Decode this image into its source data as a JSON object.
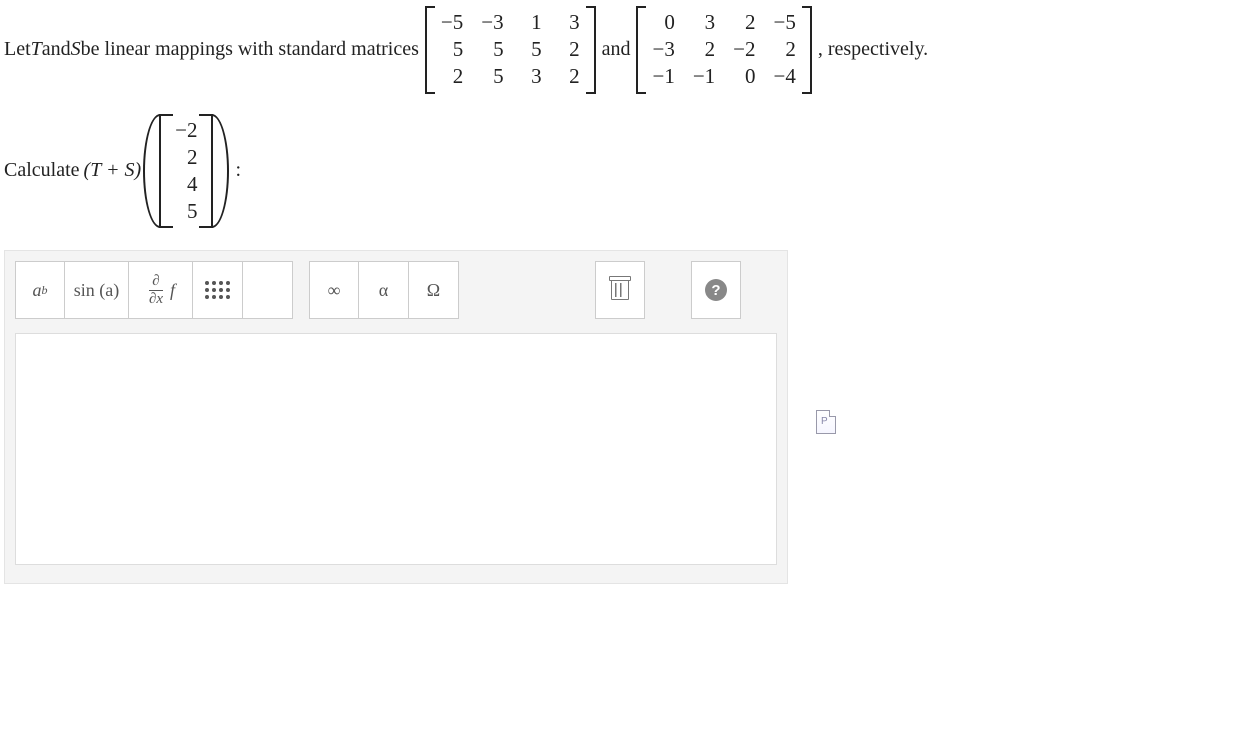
{
  "question": {
    "t1": "Let ",
    "T": "T",
    "t2": " and ",
    "S": "S",
    "t3": " be linear mappings with standard matrices ",
    "and": " and ",
    "t4": ", respectively.",
    "matrixA": [
      [
        "−5",
        "−3",
        "1",
        "3"
      ],
      [
        "5",
        "5",
        "5",
        "2"
      ],
      [
        "2",
        "5",
        "3",
        "2"
      ]
    ],
    "matrixB": [
      [
        "0",
        "3",
        "2",
        "−5"
      ],
      [
        "−3",
        "2",
        "−2",
        "2"
      ],
      [
        "−1",
        "−1",
        "0",
        "−4"
      ]
    ],
    "calc1": "Calculate ",
    "TS": "(T + S)",
    "vector": [
      "−2",
      "2",
      "4",
      "5"
    ],
    "colon": ":"
  },
  "toolbar": {
    "sup_a": "a",
    "sup_b": "b",
    "sin": "sin (a)",
    "der_num": "∂",
    "der_den": "∂x",
    "der_f": "f",
    "inf": "∞",
    "alpha": "α",
    "omega": "Ω",
    "help": "?"
  }
}
